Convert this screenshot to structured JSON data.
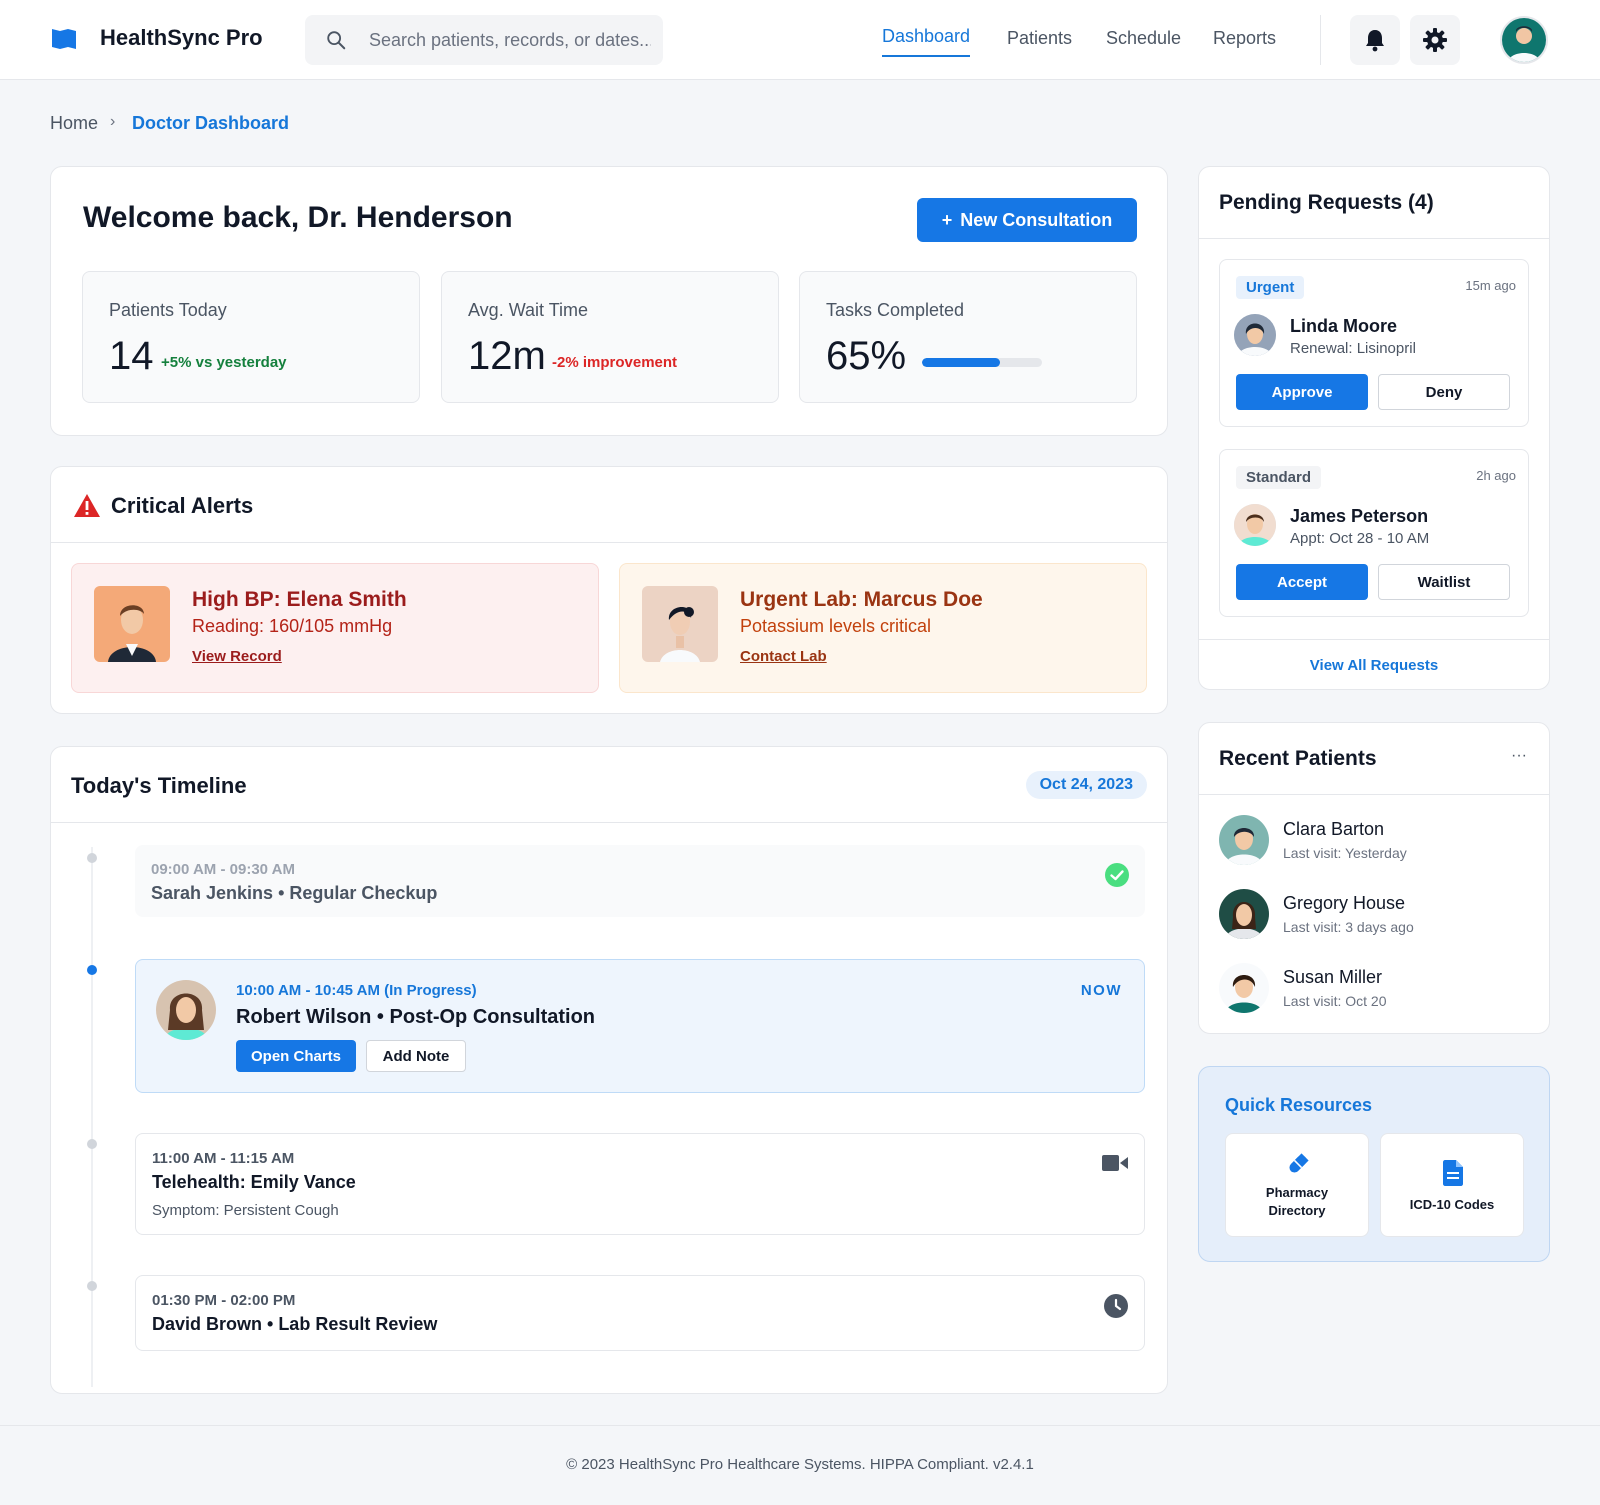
{
  "app": {
    "brand": "HealthSync Pro"
  },
  "search": {
    "placeholder": "Search patients, records, or dates..."
  },
  "nav": [
    "Dashboard",
    "Patients",
    "Schedule",
    "Reports"
  ],
  "breadcrumb": {
    "home": "Home",
    "sep": "›",
    "current": "Doctor Dashboard"
  },
  "welcome": {
    "title": "Welcome back, Dr. Henderson",
    "new_consult_icon": "+",
    "new_consult": "New Consultation",
    "stats": [
      {
        "label": "Patients Today",
        "value": "14",
        "delta": "+5% vs yesterday"
      },
      {
        "label": "Avg. Wait Time",
        "value": "12m",
        "delta": "-2% improvement"
      },
      {
        "label": "Tasks Completed",
        "value": "65%",
        "progress": 0.65
      }
    ]
  },
  "alerts": {
    "title": "Critical Alerts",
    "items": [
      {
        "title": "High BP: Elena Smith",
        "sub": "Reading: 160/105 mmHg",
        "link": "View Record"
      },
      {
        "title": "Urgent Lab: Marcus Doe",
        "sub": "Potassium levels critical",
        "link": "Contact Lab"
      }
    ]
  },
  "timeline": {
    "title": "Today's Timeline",
    "date": "Oct 24, 2023",
    "items": [
      {
        "time": "09:00 AM - 09:30 AM",
        "title": "Sarah Jenkins • Regular Checkup"
      },
      {
        "time": "10:00 AM - 10:45 AM (In Progress)",
        "title": "Robert Wilson • Post-Op Consultation",
        "now": "NOW",
        "btn1": "Open Charts",
        "btn2": "Add Note"
      },
      {
        "time": "11:00 AM - 11:15 AM",
        "title": "Telehealth: Emily Vance",
        "sub": "Symptom: Persistent Cough"
      },
      {
        "time": "01:30 PM - 02:00 PM",
        "title": "David Brown • Lab Result Review"
      }
    ]
  },
  "requests": {
    "title": "Pending Requests (4)",
    "items": [
      {
        "badge": "Urgent",
        "time": "15m ago",
        "name": "Linda Moore",
        "sub": "Renewal: Lisinopril",
        "btn1": "Approve",
        "btn2": "Deny"
      },
      {
        "badge": "Standard",
        "time": "2h ago",
        "name": "James Peterson",
        "sub": "Appt: Oct 28 - 10 AM",
        "btn1": "Accept",
        "btn2": "Waitlist"
      }
    ],
    "view_all": "View All Requests"
  },
  "recent": {
    "title": "Recent Patients",
    "more": "···",
    "items": [
      {
        "name": "Clara Barton",
        "sub": "Last visit: Yesterday"
      },
      {
        "name": "Gregory House",
        "sub": "Last visit: 3 days ago"
      },
      {
        "name": "Susan Miller",
        "sub": "Last visit: Oct 20"
      }
    ]
  },
  "resources": {
    "title": "Quick Resources",
    "items": [
      {
        "line1": "Pharmacy",
        "line2": "Directory"
      },
      {
        "line1": "ICD-10 Codes"
      }
    ]
  },
  "footer": {
    "text": "© 2023 HealthSync Pro Healthcare Systems. HIPPA Compliant. v2.4.1"
  },
  "colors": {
    "accent": "#1677e5",
    "danger": "#9b1c1c",
    "success": "#15803d"
  }
}
